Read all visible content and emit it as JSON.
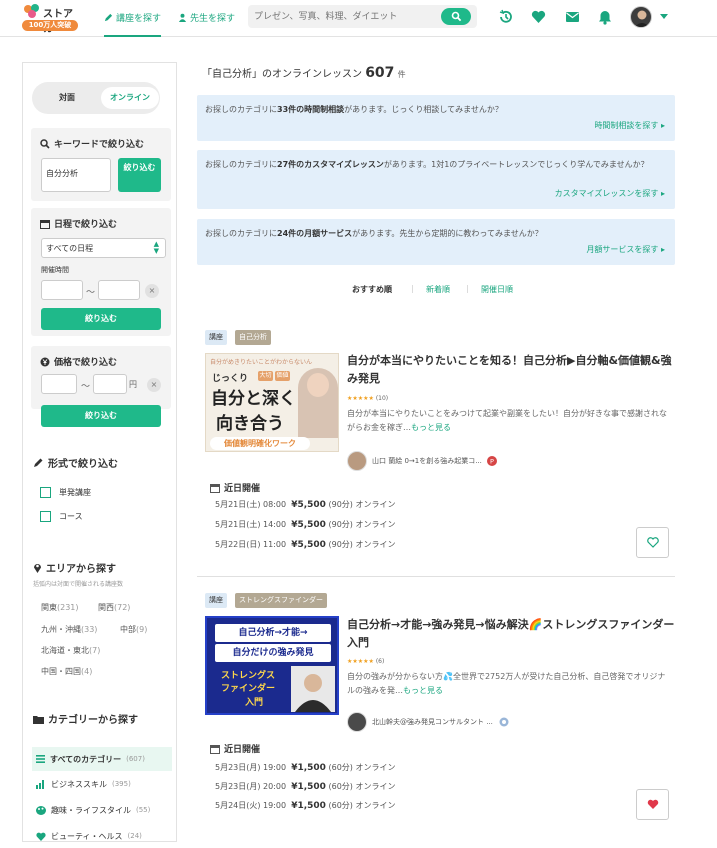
{
  "header": {
    "logo_name": "ストアカ",
    "logo_badge": "100万人突破",
    "nav_find_lesson": "講座を探す",
    "nav_find_teacher": "先生を探す",
    "search_placeholder": "プレゼン、写真、料理、ダイエット"
  },
  "sidebar": {
    "toggle_offline": "対面",
    "toggle_online": "オンライン",
    "keyword": {
      "title": "キーワードで絞り込む",
      "value": "自分分析",
      "button": "絞り込む"
    },
    "date": {
      "title": "日程で絞り込む",
      "select": "すべての日程",
      "time_label": "開催時間",
      "tilde": "〜",
      "button": "絞り込む"
    },
    "price": {
      "title": "価格で絞り込む",
      "tilde": "〜",
      "unit": "円",
      "button": "絞り込む"
    },
    "format": {
      "title": "形式で絞り込む",
      "items": [
        "単発講座",
        "コース"
      ]
    },
    "area": {
      "title": "エリアから探す",
      "note": "括弧内は対面で開催される講座数",
      "items": [
        {
          "name": "関東",
          "count": "(231)"
        },
        {
          "name": "関西",
          "count": "(72)"
        },
        {
          "name": "九州・沖縄",
          "count": "(33)"
        },
        {
          "name": "中部",
          "count": "(9)"
        },
        {
          "name": "北海道・東北",
          "count": "(7)"
        },
        {
          "name": "中国・四国",
          "count": "(4)"
        }
      ]
    },
    "category": {
      "title": "カテゴリーから探す",
      "items": [
        {
          "name": "すべてのカテゴリー",
          "count": "(607)"
        },
        {
          "name": "ビジネススキル",
          "count": "(395)"
        },
        {
          "name": "趣味・ライフスタイル",
          "count": "(55)"
        },
        {
          "name": "ビューティ・ヘルス",
          "count": "(24)"
        }
      ]
    }
  },
  "main": {
    "title_q": "「自己分析」のオンラインレッスン",
    "count": "607",
    "count_unit": "件",
    "banners": [
      {
        "pre": "お探しのカテゴリに",
        "num": "33件の",
        "bold": "時間制相談",
        "post": "があります。じっくり相談してみませんか？",
        "link": "時間制相談を探す"
      },
      {
        "pre": "お探しのカテゴリに",
        "num": "27件の",
        "bold": "カスタマイズレッスン",
        "post": "があります。1対1のプライベートレッスンでじっくり学んでみませんか？",
        "link": "カスタマイズレッスンを探す"
      },
      {
        "pre": "お探しのカテゴリに",
        "num": "24件の",
        "bold": "月額サービス",
        "post": "があります。先生から定期的に教わってみませんか？",
        "link": "月額サービスを探す"
      }
    ],
    "sort": [
      "おすすめ順",
      "新着順",
      "開催日順"
    ],
    "lessons": [
      {
        "tag1": "講座",
        "tag2": "自己分析",
        "title": "自分が本当にやりたいことを知る！自己分析▶自分軸&価値観&強み発見",
        "stars": "★★★★★",
        "reviews": "(10)",
        "desc": "自分が本当にやりたいことをみつけて起業や副業をしたい！自分が好きな事で感謝されながらお金を稼ぎ…",
        "more": "もっと見る",
        "teacher": "山口 蘭絵 0→1を創る強み起業コ...",
        "thumb_top": "自分がめきりたいことがわからないん",
        "thumb_l1": "じっくり",
        "thumb_l2": "自分と深く",
        "thumb_l3": "向き合う",
        "thumb_bottom": "価値観明確化ワーク",
        "thumb_chip1": "大切",
        "thumb_chip2": "価値",
        "near": "近日開催",
        "schedule": [
          {
            "d": "5月21日(土) 08:00",
            "p": "¥5,500",
            "m": "(90分)",
            "o": "オンライン"
          },
          {
            "d": "5月21日(土) 14:00",
            "p": "¥5,500",
            "m": "(90分)",
            "o": "オンライン"
          },
          {
            "d": "5月22日(日) 11:00",
            "p": "¥5,500",
            "m": "(90分)",
            "o": "オンライン"
          }
        ]
      },
      {
        "tag1": "講座",
        "tag2": "ストレングスファインダー",
        "title": "自己分析→才能→強み発見→悩み解決🌈ストレングスファインダー入門",
        "stars": "★★★★★",
        "reviews": "(6)",
        "desc": "自分の強みが分からない方💦全世界で2752万人が受けた自己分析、自己啓発でオリジナルの強みを発…",
        "more": "もっと見る",
        "teacher": "北山幹夫@強み発見コンサルタント ...",
        "thumb_l1": "自己分析→才能→",
        "thumb_l2": "自分だけの強み発見",
        "thumb_l3": "ストレングス",
        "thumb_l4": "ファインダー",
        "thumb_l5": "入門",
        "near": "近日開催",
        "schedule": [
          {
            "d": "5月23日(月) 19:00",
            "p": "¥1,500",
            "m": "(60分)",
            "o": "オンライン"
          },
          {
            "d": "5月23日(月) 20:00",
            "p": "¥1,500",
            "m": "(60分)",
            "o": "オンライン"
          },
          {
            "d": "5月24日(火) 19:00",
            "p": "¥1,500",
            "m": "(60分)",
            "o": "オンライン"
          }
        ]
      }
    ]
  },
  "colors": {
    "accent": "#1fb98a",
    "banner": "#e3effa",
    "badge": "#b3a893",
    "favorite": "#e0384a"
  }
}
